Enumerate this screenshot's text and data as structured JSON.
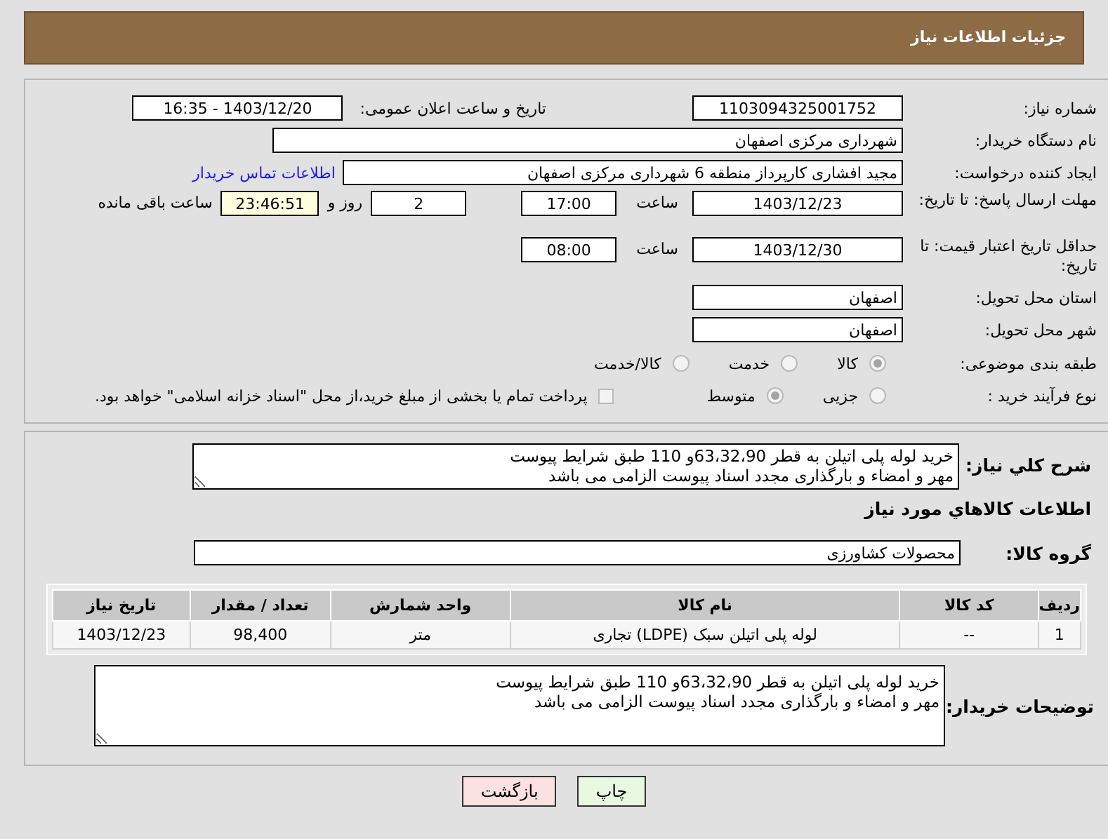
{
  "header": {
    "title": "جزئیات اطلاعات نیاز"
  },
  "need_number": {
    "label": "شماره نیاز:",
    "value": "1103094325001752"
  },
  "announce": {
    "label": "تاریخ و ساعت اعلان عمومی:",
    "value": "1403/12/20 - 16:35"
  },
  "buyer_org": {
    "label": "نام دستگاه خریدار:",
    "value": "شهرداری مرکزی اصفهان"
  },
  "creator": {
    "label": "ایجاد کننده درخواست:",
    "value": "مجید افشاری کارپرداز منطقه 6 شهرداری مرکزی اصفهان",
    "link": "اطلاعات تماس خریدار"
  },
  "deadline": {
    "label": "مهلت ارسال پاسخ: تا تاریخ:",
    "date": "1403/12/23",
    "time_label": "ساعت",
    "time": "17:00",
    "days": "2",
    "days_label": "روز و",
    "remaining": "23:46:51",
    "remaining_label": "ساعت باقی مانده"
  },
  "price_validity": {
    "label": "حداقل تاریخ اعتبار قیمت: تا تاریخ:",
    "date": "1403/12/30",
    "time_label": "ساعت",
    "time": "08:00"
  },
  "province": {
    "label": "استان محل تحویل:",
    "value": "اصفهان"
  },
  "city": {
    "label": "شهر محل تحویل:",
    "value": "اصفهان"
  },
  "category": {
    "label": "طبقه بندی موضوعی:",
    "options": [
      {
        "label": "کالا",
        "selected": true
      },
      {
        "label": "خدمت",
        "selected": false
      },
      {
        "label": "کالا/خدمت",
        "selected": false
      }
    ]
  },
  "process": {
    "label": "نوع فرآیند خرید :",
    "options": [
      {
        "label": "جزیی",
        "selected": false
      },
      {
        "label": "متوسط",
        "selected": true
      }
    ],
    "treasury": {
      "label": "پرداخت تمام یا بخشی از مبلغ خرید،از محل \"اسناد خزانه اسلامی\" خواهد بود.",
      "checked": false
    }
  },
  "description": {
    "label": "شرح کلي نياز:",
    "value": "خرید لوله پلی اتیلن به قطر 63،32،90و 110 طبق شرایط پیوست\nمهر و امضاء و بارگذاری مجدد اسناد پیوست الزامی می باشد"
  },
  "goods_heading": "اطلاعات كالاهاي مورد نياز",
  "goods_group": {
    "label": "گروه كالا:",
    "value": "محصولات کشاورزی"
  },
  "table": {
    "columns": [
      "ردیف",
      "کد کالا",
      "نام کالا",
      "واحد شمارش",
      "تعداد / مقدار",
      "تاریخ نیاز"
    ],
    "rows": [
      [
        "1",
        "--",
        "لوله پلی اتیلن سبک (LDPE) تجاری",
        "متر",
        "98,400",
        "1403/12/23"
      ]
    ]
  },
  "buyer_notes": {
    "label": "توضیحات خریدار:",
    "value": "خرید لوله پلی اتیلن به قطر 63،32،90و 110 طبق شرایط پیوست\nمهر و امضاء و بارگذاری مجدد اسناد پیوست الزامی می باشد"
  },
  "buttons": [
    {
      "kind": "print",
      "label": "چاپ"
    },
    {
      "kind": "back",
      "label": "بازگشت"
    }
  ]
}
